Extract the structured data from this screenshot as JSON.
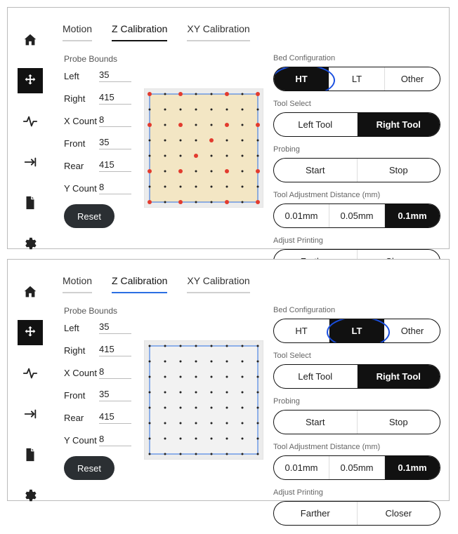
{
  "panels": [
    {
      "tabs": [
        "Motion",
        "Z Calibration",
        "XY Calibration"
      ],
      "active_tab": 1,
      "active_tab_blue": false,
      "probe_bounds": {
        "title": "Probe Bounds",
        "rows": [
          {
            "label": "Left",
            "value": "35"
          },
          {
            "label": "Right",
            "value": "415"
          },
          {
            "label": "X Count",
            "value": "8"
          },
          {
            "label": "Front",
            "value": "35"
          },
          {
            "label": "Rear",
            "value": "415"
          },
          {
            "label": "Y Count",
            "value": "8"
          }
        ],
        "reset_label": "Reset"
      },
      "grid": {
        "cols": 8,
        "rows": 8,
        "bed_fill": "#f3e6c4",
        "show_red_pattern": true
      },
      "right_sections": [
        {
          "label": "Bed Configuration",
          "options": [
            "HT",
            "LT",
            "Other"
          ],
          "selected": 0,
          "circle": 0
        },
        {
          "label": "Tool Select",
          "options": [
            "Left Tool",
            "Right Tool"
          ],
          "selected": 1
        },
        {
          "label": "Probing",
          "options": [
            "Start",
            "Stop"
          ],
          "selected": -1
        },
        {
          "label": "Tool Adjustment Distance (mm)",
          "options": [
            "0.01mm",
            "0.05mm",
            "0.1mm"
          ],
          "selected": 2
        },
        {
          "label": "Adjust Printing",
          "options": [
            "Farther",
            "Closer"
          ],
          "selected": -1
        }
      ]
    },
    {
      "tabs": [
        "Motion",
        "Z Calibration",
        "XY Calibration"
      ],
      "active_tab": 1,
      "active_tab_blue": true,
      "probe_bounds": {
        "title": "Probe Bounds",
        "rows": [
          {
            "label": "Left",
            "value": "35"
          },
          {
            "label": "Right",
            "value": "415"
          },
          {
            "label": "X Count",
            "value": "8"
          },
          {
            "label": "Front",
            "value": "35"
          },
          {
            "label": "Rear",
            "value": "415"
          },
          {
            "label": "Y Count",
            "value": "8"
          }
        ],
        "reset_label": "Reset"
      },
      "grid": {
        "cols": 8,
        "rows": 8,
        "bed_fill": "#f2f2f2",
        "show_red_pattern": false
      },
      "right_sections": [
        {
          "label": "Bed Configuration",
          "options": [
            "HT",
            "LT",
            "Other"
          ],
          "selected": 1,
          "circle": 1
        },
        {
          "label": "Tool Select",
          "options": [
            "Left Tool",
            "Right Tool"
          ],
          "selected": 1
        },
        {
          "label": "Probing",
          "options": [
            "Start",
            "Stop"
          ],
          "selected": -1
        },
        {
          "label": "Tool Adjustment Distance (mm)",
          "options": [
            "0.01mm",
            "0.05mm",
            "0.1mm"
          ],
          "selected": 2
        },
        {
          "label": "Adjust Printing",
          "options": [
            "Farther",
            "Closer"
          ],
          "selected": -1
        }
      ]
    }
  ],
  "icons": [
    "home",
    "move",
    "activity",
    "align-right",
    "file",
    "settings"
  ],
  "active_icon": 1
}
